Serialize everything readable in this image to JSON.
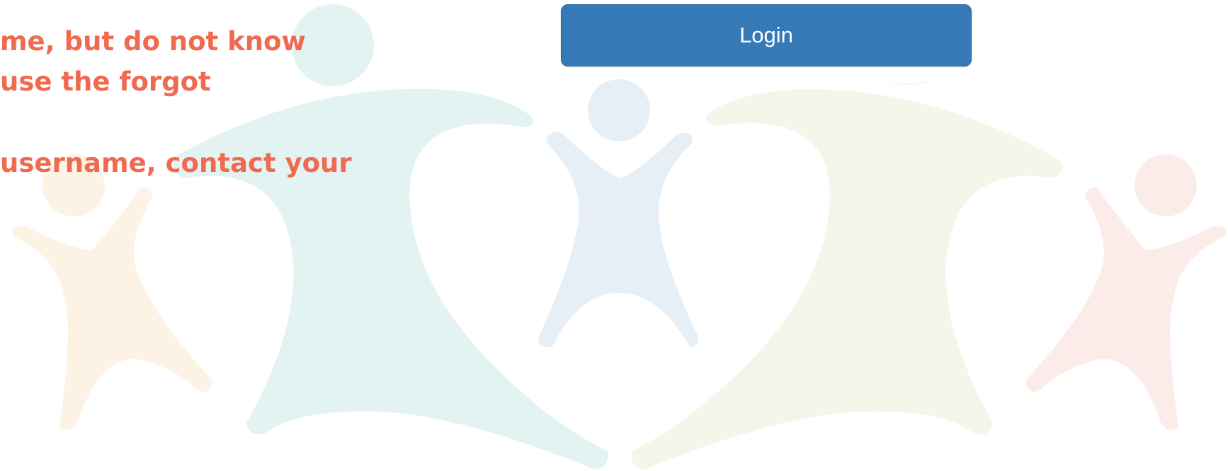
{
  "help": {
    "line1": "me, but do not know",
    "line2": "use the forgot",
    "line3": "username, contact your"
  },
  "login": {
    "label": "Login"
  },
  "colors": {
    "help_text": "#EF6A4F",
    "button_bg": "#3579B6",
    "button_text": "#FFFFFF",
    "figure_orange": "#FCF3E4",
    "figure_teal": "#E3F3F2",
    "figure_blue": "#E6EEF6",
    "figure_green": "#F2F7EA",
    "figure_pink": "#FBECEA"
  }
}
